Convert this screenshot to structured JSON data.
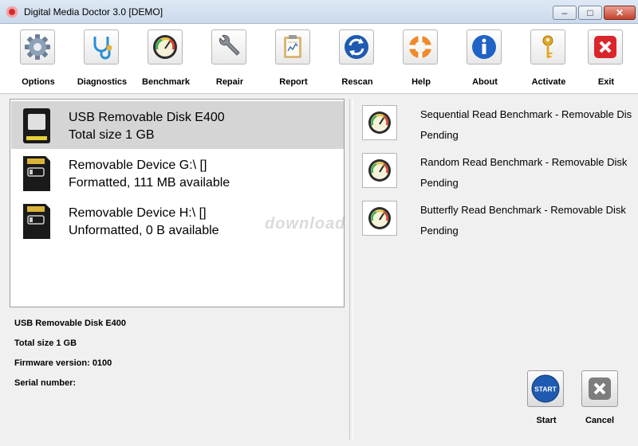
{
  "window": {
    "title": "Digital Media Doctor 3.0 [DEMO]",
    "min_glyph": "–",
    "max_glyph": "□",
    "close_glyph": "✕"
  },
  "toolbar": [
    {
      "label": "Options",
      "icon": "gear-icon"
    },
    {
      "label": "Diagnostics",
      "icon": "stethoscope-icon"
    },
    {
      "label": "Benchmark",
      "icon": "gauge-icon"
    },
    {
      "label": "Repair",
      "icon": "wrench-icon"
    },
    {
      "label": "Report",
      "icon": "clipboard-icon"
    },
    {
      "label": "Rescan",
      "icon": "refresh-icon"
    },
    {
      "label": "Help",
      "icon": "lifebuoy-icon"
    },
    {
      "label": "About",
      "icon": "info-icon"
    },
    {
      "label": "Activate",
      "icon": "key-icon"
    },
    {
      "label": "Exit",
      "icon": "exit-icon"
    }
  ],
  "devices": [
    {
      "name": "USB Removable Disk E400",
      "detail": "Total size 1 GB",
      "selected": true
    },
    {
      "name": "Removable Device G:\\ []",
      "detail": "Formatted, 111 MB available",
      "selected": false
    },
    {
      "name": "Removable Device H:\\ []",
      "detail": "Unformatted, 0 B available",
      "selected": false
    }
  ],
  "details": {
    "name": "USB Removable Disk E400",
    "size": "Total size 1 GB",
    "firmware": "Firmware version: 0100",
    "serial": "Serial number:"
  },
  "benchmarks": [
    {
      "name": "Sequential Read Benchmark - Removable Dis",
      "status": "Pending"
    },
    {
      "name": "Random Read Benchmark - Removable Disk",
      "status": "Pending"
    },
    {
      "name": "Butterfly Read Benchmark - Removable Disk",
      "status": "Pending"
    }
  ],
  "actions": {
    "start_label": "Start",
    "start_icon_text": "START",
    "cancel_label": "Cancel"
  },
  "watermark": "download",
  "colors": {
    "accent_red": "#d32b2b",
    "selection_bg": "#d5d5d5",
    "start_blue": "#1e5bb0"
  }
}
